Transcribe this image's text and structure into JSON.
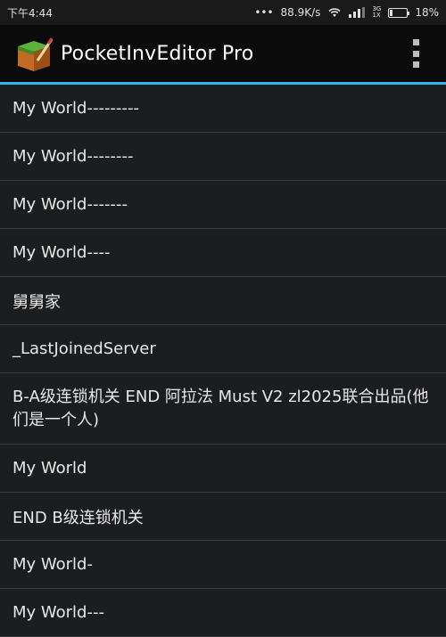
{
  "status": {
    "time": "下午4:44",
    "dots": "•••",
    "speed": "88.9K/s",
    "network_top": "3G",
    "network_bottom": "1X",
    "battery": "18%",
    "battery_level": 0.18
  },
  "app_bar": {
    "title": "PocketInvEditor Pro",
    "icon": "minecraft-block-icon",
    "overflow_icon": "more-vert-icon"
  },
  "worlds": [
    {
      "label": "My World---------"
    },
    {
      "label": "My World--------"
    },
    {
      "label": "My World-------"
    },
    {
      "label": "My World----"
    },
    {
      "label": "舅舅家"
    },
    {
      "label": "_LastJoinedServer"
    },
    {
      "label": "B-A级连锁机关 END 阿拉法 Must V2 zl2025联合出品(他们是一个人)"
    },
    {
      "label": "My World"
    },
    {
      "label": "END B级连锁机关"
    },
    {
      "label": "My World-"
    },
    {
      "label": "My World---"
    }
  ],
  "colors": {
    "accent": "#33b5e5",
    "background": "#1c1d1f",
    "divider": "#3a3b3d"
  }
}
